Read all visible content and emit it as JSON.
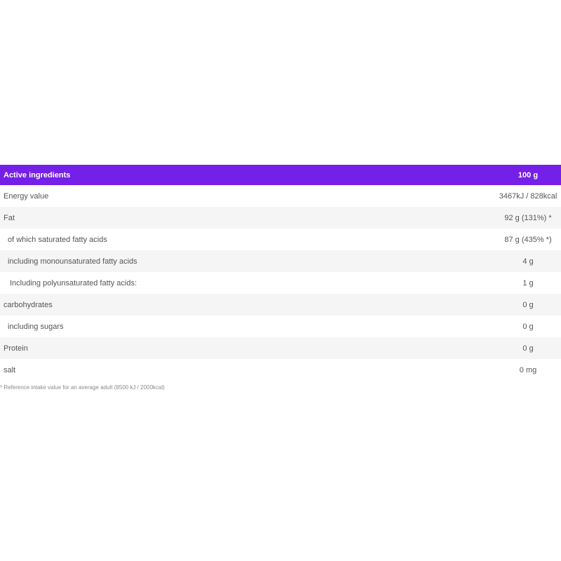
{
  "table": {
    "header": {
      "name": "Active ingredients",
      "value": "100 g"
    },
    "rows": [
      {
        "name": "Energy value",
        "value": "3467kJ / 828kcal",
        "indent": 0
      },
      {
        "name": "Fat",
        "value": "92 g (131%) *",
        "indent": 0
      },
      {
        "name": "of which saturated fatty acids",
        "value": "87 g (435% *)",
        "indent": 1
      },
      {
        "name": "including monounsaturated fatty acids",
        "value": "4 g",
        "indent": 1
      },
      {
        "name": "Including polyunsaturated fatty acids:",
        "value": "1 g",
        "indent": 2
      },
      {
        "name": "carbohydrates",
        "value": "0 g",
        "indent": 0
      },
      {
        "name": "including sugars",
        "value": "0 g",
        "indent": 1
      },
      {
        "name": "Protein",
        "value": "0 g",
        "indent": 0
      },
      {
        "name": "salt",
        "value": "0 mg",
        "indent": 0
      }
    ]
  },
  "footnote": "* Reference intake value for an average adult   (8500 kJ / 2000kcal)",
  "colors": {
    "header_bg": "#7520e8",
    "header_text": "#ffffff",
    "row_alt_bg": "#f5f5f5",
    "row_text": "#555555"
  }
}
